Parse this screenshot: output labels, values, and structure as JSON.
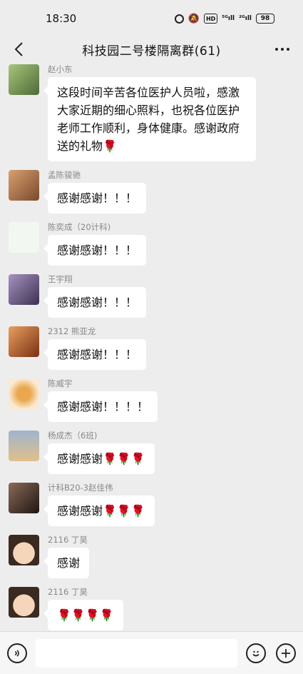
{
  "status_bar": {
    "time": "18:30",
    "signal_1": "⁵ᴳıll",
    "signal_2": "²ᴳıll",
    "hd": "HD",
    "battery": "98"
  },
  "nav": {
    "title": "科技园二号楼隔离群(61)",
    "back_icon": "chevron-left-icon",
    "more_icon": "more-dots-icon"
  },
  "messages": [
    {
      "sender": "赵小东",
      "text": "这段时间辛苦各位医护人员啦，感激大家近期的细心照料，也祝各位医护老师工作顺利，身体健康。感谢政府送的礼物🌹",
      "avatar_color": "#6c8a52"
    },
    {
      "sender": "孟陈骏驰",
      "text": "感谢感谢！！！",
      "avatar_color": "#b07a4e"
    },
    {
      "sender": "陈奕成（20计科)",
      "text": "感谢感谢！！！",
      "avatar_color": "#f3f7f1"
    },
    {
      "sender": "王宇翔",
      "text": "感谢感谢！！！",
      "avatar_color": "#6e5c8d"
    },
    {
      "sender": "2312 熊亚龙",
      "text": "感谢感谢！！！",
      "avatar_color": "#c46a2e"
    },
    {
      "sender": "陈威宇",
      "text": "感谢感谢！！！！",
      "avatar_color": "#e8c28a"
    },
    {
      "sender": "杨成杰（6班)",
      "text": "感谢感谢🌹🌹🌹",
      "avatar_color": "#7f95b3"
    },
    {
      "sender": "计科B20-3赵佳伟",
      "text": "感谢感谢🌹🌹🌹",
      "avatar_color": "#4a3a30"
    },
    {
      "sender": "2116 丁昊",
      "text": "感谢",
      "avatar_color": "#f1c9a8"
    },
    {
      "sender": "2116 丁昊",
      "text": "🌹🌹🌹🌹",
      "avatar_color": "#f1c9a8"
    }
  ],
  "input_bar": {
    "voice_icon": "voice-icon",
    "emoji_icon": "emoji-icon",
    "plus_icon": "plus-icon"
  }
}
